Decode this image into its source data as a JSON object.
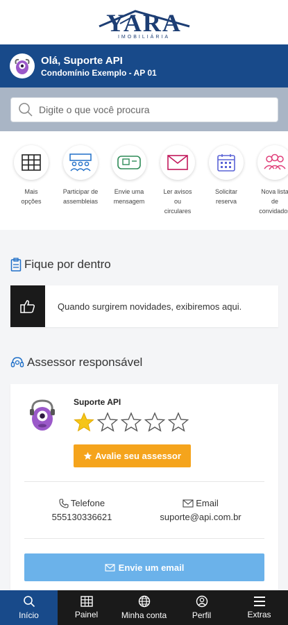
{
  "brand": {
    "name": "YARA",
    "subtitle": "IMOBILIÁRIA"
  },
  "header": {
    "greeting": "Olá, Suporte API",
    "condo": "Condomínio Exemplo - AP 01",
    "avatar_icon": "monster-avatar-icon"
  },
  "search": {
    "placeholder": "Digite o que você procura",
    "value": ""
  },
  "shortcuts": [
    {
      "icon": "grid-icon",
      "label": "Mais opções"
    },
    {
      "icon": "assembly-icon",
      "label": "Participar de assembleias"
    },
    {
      "icon": "message-icon",
      "label": "Envie uma mensagem"
    },
    {
      "icon": "envelope-icon",
      "label": "Ler avisos ou circulares"
    },
    {
      "icon": "calendar-icon",
      "label": "Solicitar reserva"
    },
    {
      "icon": "guests-icon",
      "label": "Nova lista de convidados"
    }
  ],
  "news_section": {
    "title": "Fique por dentro",
    "empty_text": "Quando surgirem novidades, exibiremos aqui."
  },
  "advisor_section": {
    "title": "Assessor responsável",
    "name": "Suporte API",
    "rating": 1,
    "rating_max": 5,
    "rate_button": "Avalie seu assessor",
    "phone_label": "Telefone",
    "phone": "555130336621",
    "email_label": "Email",
    "email": "suporte@api.com.br",
    "email_button": "Envie um email"
  },
  "bottom_nav": [
    {
      "icon": "search-icon",
      "label": "Início",
      "active": true
    },
    {
      "icon": "panel-icon",
      "label": "Painel",
      "active": false
    },
    {
      "icon": "globe-icon",
      "label": "Minha conta",
      "active": false
    },
    {
      "icon": "user-icon",
      "label": "Perfil",
      "active": false
    },
    {
      "icon": "menu-icon",
      "label": "Extras",
      "active": false
    }
  ],
  "colors": {
    "primary": "#184a8a",
    "accent": "#f5a41c",
    "email_button": "#6bb2ea",
    "nav_bg": "#1a1a1a"
  }
}
